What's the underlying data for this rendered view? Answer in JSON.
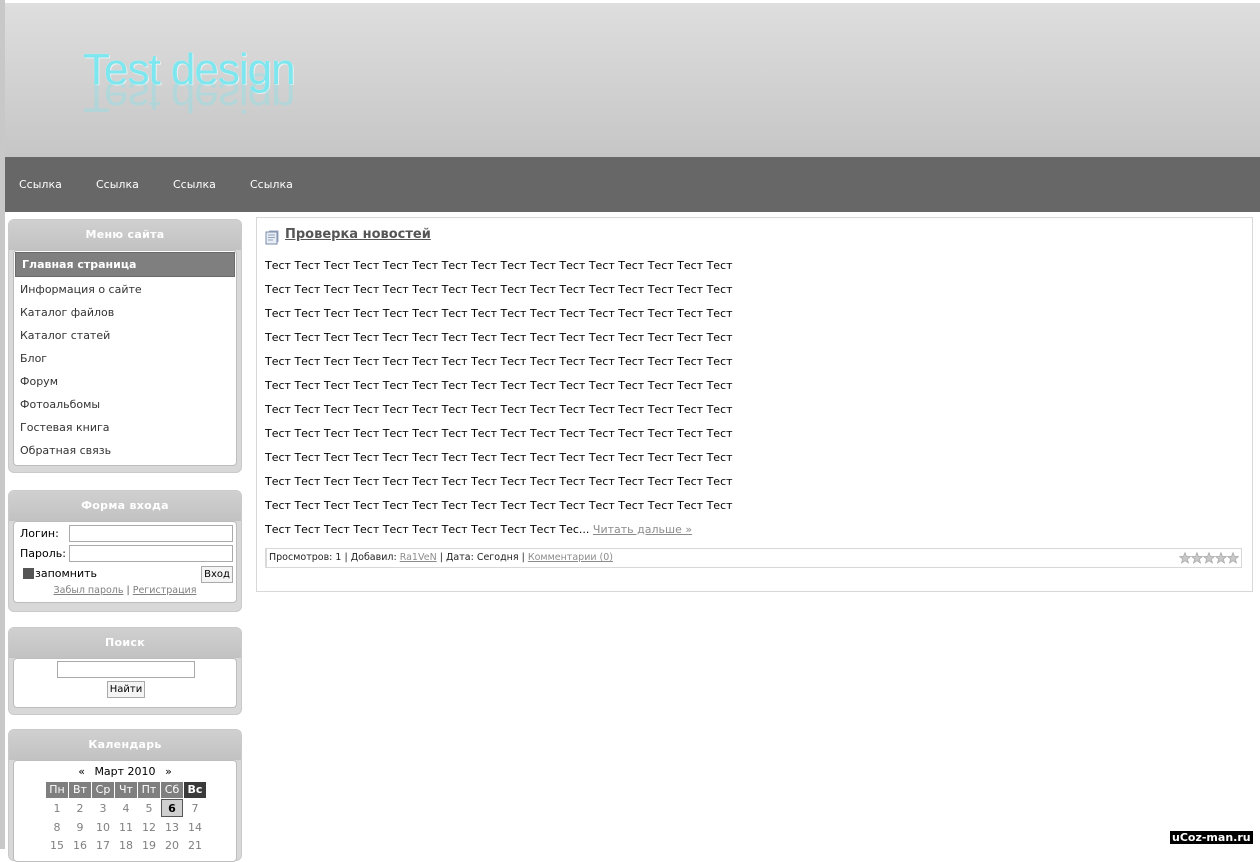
{
  "header": {
    "logo_text": "Test design"
  },
  "nav": {
    "links": [
      "Ссылка",
      "Ссылка",
      "Ссылка",
      "Ссылка"
    ]
  },
  "menu": {
    "title": "Меню сайта",
    "items": [
      "Главная страница",
      "Информация о сайте",
      "Каталог файлов",
      "Каталог статей",
      "Блог",
      "Форум",
      "Фотоальбомы",
      "Гостевая книга",
      "Обратная связь"
    ]
  },
  "login": {
    "title": "Форма входа",
    "login_label": "Логин:",
    "password_label": "Пароль:",
    "remember_label": "запомнить",
    "submit_label": "Вход",
    "forgot_label": "Забыл пароль",
    "separator": "|",
    "register_label": "Регистрация"
  },
  "search": {
    "title": "Поиск",
    "button_label": "Найти"
  },
  "calendar": {
    "title": "Календарь",
    "prev": "«",
    "month": "Март 2010",
    "next": "»",
    "weekdays": [
      "Пн",
      "Вт",
      "Ср",
      "Чт",
      "Пт",
      "Сб",
      "Вс"
    ],
    "weeks": [
      [
        "1",
        "2",
        "3",
        "4",
        "5",
        "6",
        "7"
      ],
      [
        "8",
        "9",
        "10",
        "11",
        "12",
        "13",
        "14"
      ],
      [
        "15",
        "16",
        "17",
        "18",
        "19",
        "20",
        "21"
      ]
    ],
    "today": "6"
  },
  "news": {
    "title": "Проверка новостей",
    "lines": [
      "Тест Тест Тест Тест Тест Тест Тест Тест Тест Тест Тест Тест Тест Тест Тест Тест",
      "Тест Тест Тест Тест Тест Тест Тест Тест Тест Тест Тест Тест Тест Тест Тест Тест",
      "Тест Тест Тест Тест Тест Тест Тест Тест Тест Тест Тест Тест Тест Тест Тест Тест",
      "Тест Тест Тест Тест Тест Тест Тест Тест Тест Тест Тест Тест Тест Тест Тест Тест",
      "Тест Тест Тест Тест Тест Тест Тест Тест Тест Тест Тест Тест Тест Тест Тест Тест",
      "Тест Тест Тест Тест Тест Тест Тест Тест Тест Тест Тест Тест Тест Тест Тест Тест",
      "Тест Тест Тест Тест Тест Тест Тест Тест Тест Тест Тест Тест Тест Тест Тест Тест",
      "Тест Тест Тест Тест Тест Тест Тест Тест Тест Тест Тест Тест Тест Тест Тест Тест",
      "Тест Тест Тест Тест Тест Тест Тест Тест Тест Тест Тест Тест Тест Тест Тест Тест",
      "Тест Тест Тест Тест Тест Тест Тест Тест Тест Тест Тест Тест Тест Тест Тест Тест",
      "Тест Тест Тест Тест Тест Тест Тест Тест Тест Тест Тест Тест Тест Тест Тест Тест"
    ],
    "last_line": "Тест Тест Тест Тест Тест Тест Тест Тест Тест Тест Тес...",
    "read_more": "Читать дальше »",
    "views_label": "Просмотров:",
    "views": "1",
    "sep": "|",
    "added_label": "Добавил:",
    "author": "Ra1VeN",
    "date_label": "Дата:",
    "date": "Сегодня",
    "comments": "Комментарии (0)",
    "rating_stars": 5
  },
  "watermark": "uCoz-man.ru"
}
